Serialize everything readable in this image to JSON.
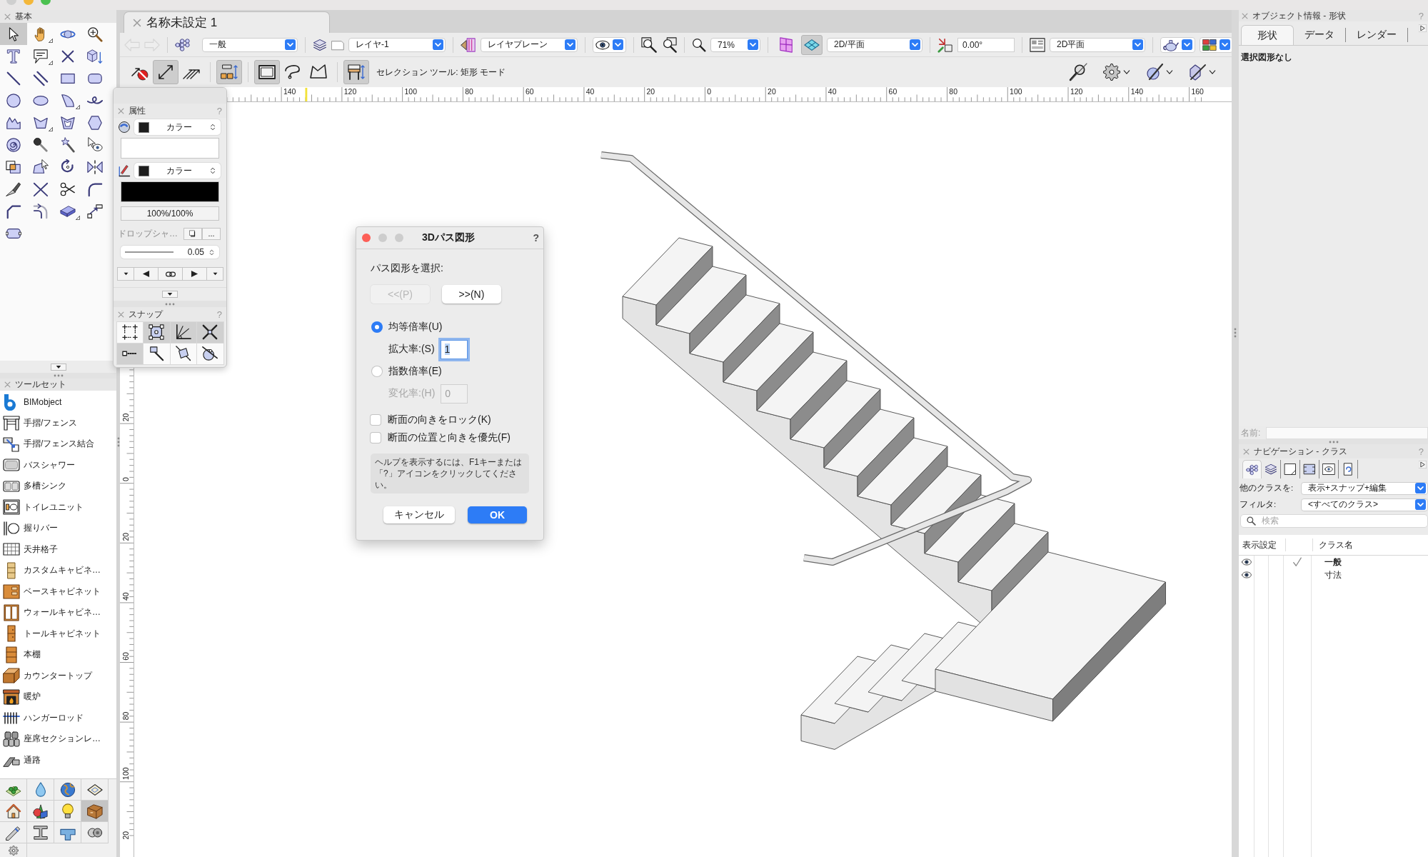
{
  "basic_palette": {
    "title": "基本",
    "tools": [
      {
        "kind": "pointer",
        "selected": true,
        "flyout": false
      },
      {
        "kind": "pan",
        "selected": false,
        "flyout": true
      },
      {
        "kind": "flyover",
        "selected": false,
        "flyout": false
      },
      {
        "kind": "zoom",
        "selected": false,
        "flyout": false
      },
      {
        "kind": "text",
        "selected": false,
        "flyout": false
      },
      {
        "kind": "callout",
        "selected": false,
        "flyout": true
      },
      {
        "kind": "locus",
        "selected": false,
        "flyout": false
      },
      {
        "kind": "pushpull",
        "selected": false,
        "flyout": false
      },
      {
        "kind": "line",
        "selected": false,
        "flyout": false
      },
      {
        "kind": "doubleline",
        "selected": false,
        "flyout": false
      },
      {
        "kind": "rectangle",
        "selected": false,
        "flyout": false
      },
      {
        "kind": "roundrect",
        "selected": false,
        "flyout": false
      },
      {
        "kind": "circle",
        "selected": false,
        "flyout": false
      },
      {
        "kind": "oval",
        "selected": false,
        "flyout": false
      },
      {
        "kind": "arc",
        "selected": false,
        "flyout": true
      },
      {
        "kind": "freehand",
        "selected": false,
        "flyout": false
      },
      {
        "kind": "polyline",
        "selected": false,
        "flyout": false
      },
      {
        "kind": "polygon",
        "selected": false,
        "flyout": true
      },
      {
        "kind": "doublepolygon",
        "selected": false,
        "flyout": false
      },
      {
        "kind": "hexagon",
        "selected": false,
        "flyout": false
      },
      {
        "kind": "spiral",
        "selected": false,
        "flyout": false
      },
      {
        "kind": "eyedropper",
        "selected": false,
        "flyout": false
      },
      {
        "kind": "wand",
        "selected": false,
        "flyout": false
      },
      {
        "kind": "visibility",
        "selected": false,
        "flyout": false
      },
      {
        "kind": "resize",
        "selected": false,
        "flyout": false
      },
      {
        "kind": "reshape",
        "selected": false,
        "flyout": false
      },
      {
        "kind": "rotate",
        "selected": false,
        "flyout": false
      },
      {
        "kind": "mirror",
        "selected": false,
        "flyout": false
      },
      {
        "kind": "knife",
        "selected": false,
        "flyout": false
      },
      {
        "kind": "connect",
        "selected": false,
        "flyout": false
      },
      {
        "kind": "scissors",
        "selected": false,
        "flyout": false
      },
      {
        "kind": "fillet",
        "selected": false,
        "flyout": false
      },
      {
        "kind": "chamfer",
        "selected": false,
        "flyout": false
      },
      {
        "kind": "offset",
        "selected": false,
        "flyout": false
      },
      {
        "kind": "slab",
        "selected": false,
        "flyout": true
      },
      {
        "kind": "move",
        "selected": false,
        "flyout": false
      },
      {
        "kind": "capsule",
        "selected": false,
        "flyout": false
      }
    ]
  },
  "toolset_palette": {
    "title": "ツールセット",
    "tools": [
      {
        "kind": "bimobject",
        "label": "BIMobject"
      },
      {
        "kind": "railing",
        "label": "手摺/フェンス"
      },
      {
        "kind": "railjoin",
        "label": "手摺/フェンス結合"
      },
      {
        "kind": "bathtub",
        "label": "バスシャワー"
      },
      {
        "kind": "sink",
        "label": "多槽シンク"
      },
      {
        "kind": "toilet",
        "label": "トイレユニット"
      },
      {
        "kind": "grabbar",
        "label": "握りバー"
      },
      {
        "kind": "ceiling",
        "label": "天井格子"
      },
      {
        "kind": "customcabinet",
        "label": "カスタムキャビネ…"
      },
      {
        "kind": "basecabinet",
        "label": "ベースキャビネット"
      },
      {
        "kind": "wallcabinet",
        "label": "ウォールキャビネ…"
      },
      {
        "kind": "tallcabinet",
        "label": "トールキャビネット"
      },
      {
        "kind": "bookshelf",
        "label": "本棚"
      },
      {
        "kind": "countertop",
        "label": "カウンタートップ"
      },
      {
        "kind": "fireplace",
        "label": "暖炉"
      },
      {
        "kind": "hangerrod",
        "label": "ハンガーロッド"
      },
      {
        "kind": "seating",
        "label": "座席セクションレ…"
      },
      {
        "kind": "walkway",
        "label": "通路"
      }
    ],
    "sets": [
      {
        "kind": "site",
        "selected": false
      },
      {
        "kind": "water",
        "selected": false
      },
      {
        "kind": "globe",
        "selected": false
      },
      {
        "kind": "plansheet",
        "selected": false
      },
      {
        "kind": "house",
        "selected": false
      },
      {
        "kind": "shapes",
        "selected": false
      },
      {
        "kind": "bulb",
        "selected": false
      },
      {
        "kind": "furniture",
        "selected": true
      },
      {
        "kind": "draft",
        "selected": false
      },
      {
        "kind": "beam",
        "selected": false
      },
      {
        "kind": "pipe",
        "selected": false
      },
      {
        "kind": "knob",
        "selected": false
      },
      {
        "kind": "gear",
        "selected": false
      }
    ]
  },
  "document": {
    "tab": "名称未設定 1"
  },
  "view_bar": {
    "history": [
      {
        "kind": "back",
        "disabled": true
      },
      {
        "kind": "forward",
        "disabled": true
      }
    ],
    "class": "一般",
    "layer": "レイヤ-1",
    "layer_plane": "レイヤプレーン",
    "zoom": "71%",
    "views": [
      {
        "kind": "gridview",
        "selected": false
      },
      {
        "kind": "planview",
        "selected": true
      }
    ],
    "view": "2D/平面",
    "rotation": "0.00°",
    "render": "2D平面"
  },
  "mode_bar": {
    "groups": [
      [
        {
          "kind": "nosnap",
          "selected": false
        },
        {
          "kind": "single",
          "selected": true
        },
        {
          "kind": "multiple",
          "selected": false
        }
      ],
      [
        {
          "kind": "transform",
          "selected": true
        }
      ],
      [
        {
          "kind": "marquee",
          "selected": true
        },
        {
          "kind": "lasso",
          "selected": false
        },
        {
          "kind": "polyselect",
          "selected": false
        }
      ],
      [
        {
          "kind": "pickup",
          "selected": true
        }
      ]
    ],
    "hint": "セレクション ツール: 矩形 モード"
  },
  "rulers": {
    "horizontal": [
      "140",
      "120",
      "100",
      "80",
      "60",
      "40",
      "20",
      "0",
      "20",
      "40",
      "60",
      "80",
      "100",
      "120",
      "140",
      "160"
    ],
    "vertical": [
      "20",
      "0",
      "20",
      "40",
      "60",
      "80",
      "100",
      "20"
    ]
  },
  "attributes_palette": {
    "title": "属性",
    "help": "?",
    "fill_style": "カラー",
    "pen_style": "カラー",
    "opacity": "100%/100%",
    "drop_shadow": "ドロップシャ…",
    "shadow_more": "...",
    "line_weight": "0.05"
  },
  "snap_palette": {
    "title": "スナップ",
    "help": "?",
    "tools": [
      {
        "kind": "snapgrid",
        "selected": false
      },
      {
        "kind": "snapobject",
        "selected": true
      },
      {
        "kind": "snapangle",
        "selected": true
      },
      {
        "kind": "snapintersection",
        "selected": true
      },
      {
        "kind": "snapdistance",
        "selected": true
      },
      {
        "kind": "snappoint",
        "selected": false
      },
      {
        "kind": "snapedge",
        "selected": false
      },
      {
        "kind": "snaptangent",
        "selected": false
      }
    ]
  },
  "dialog": {
    "title": "3Dパス図形",
    "help": "?",
    "prompt": "パス図形を選択:",
    "nav": [
      {
        "label": "<<(P)",
        "disabled": true
      },
      {
        "label": ">>(N)",
        "disabled": false
      }
    ],
    "scale_modes": [
      {
        "label": "均等倍率(U)",
        "selected": true,
        "field": {
          "label": "拡大率:(S)",
          "value": "1",
          "disabled": false,
          "focused": true
        }
      },
      {
        "label": "指数倍率(E)",
        "selected": false,
        "field": {
          "label": "変化率:(H)",
          "value": "0",
          "disabled": true,
          "focused": false
        }
      }
    ],
    "checkboxes": [
      {
        "label": "断面の向きをロック(K)",
        "checked": false
      },
      {
        "label": "断面の位置と向きを優先(F)",
        "checked": false
      }
    ],
    "help_text": "ヘルプを表示するには、F1キーまたは「?」アイコンをクリックしてください。",
    "cancel": "キャンセル",
    "ok": "OK"
  },
  "object_info": {
    "title": "オブジェクト情報 - 形状",
    "help": "?",
    "tabs": [
      {
        "label": "形状",
        "selected": true
      },
      {
        "label": "データ",
        "selected": false
      },
      {
        "label": "レンダー",
        "selected": false
      }
    ],
    "message": "選択図形なし",
    "name_label": "名前:"
  },
  "navigation": {
    "title": "ナビゲーション - クラス",
    "help": "?",
    "tabs": [
      {
        "kind": "classes",
        "selected": true
      },
      {
        "kind": "layers",
        "selected": false
      },
      {
        "kind": "sheets",
        "selected": false
      },
      {
        "kind": "viewports",
        "selected": false
      },
      {
        "kind": "views",
        "selected": false
      },
      {
        "kind": "references",
        "selected": false
      }
    ],
    "others": {
      "label": "他のクラスを:",
      "value": "表示+スナップ+編集"
    },
    "filter": {
      "label": "フィルタ:",
      "value": "<すべてのクラス>"
    },
    "search": {
      "placeholder": "検索"
    },
    "columns": [
      "表示設定",
      "クラス名"
    ],
    "rows": [
      {
        "visible": true,
        "active": true,
        "name": "一般"
      },
      {
        "visible": true,
        "active": false,
        "name": "寸法"
      }
    ]
  }
}
